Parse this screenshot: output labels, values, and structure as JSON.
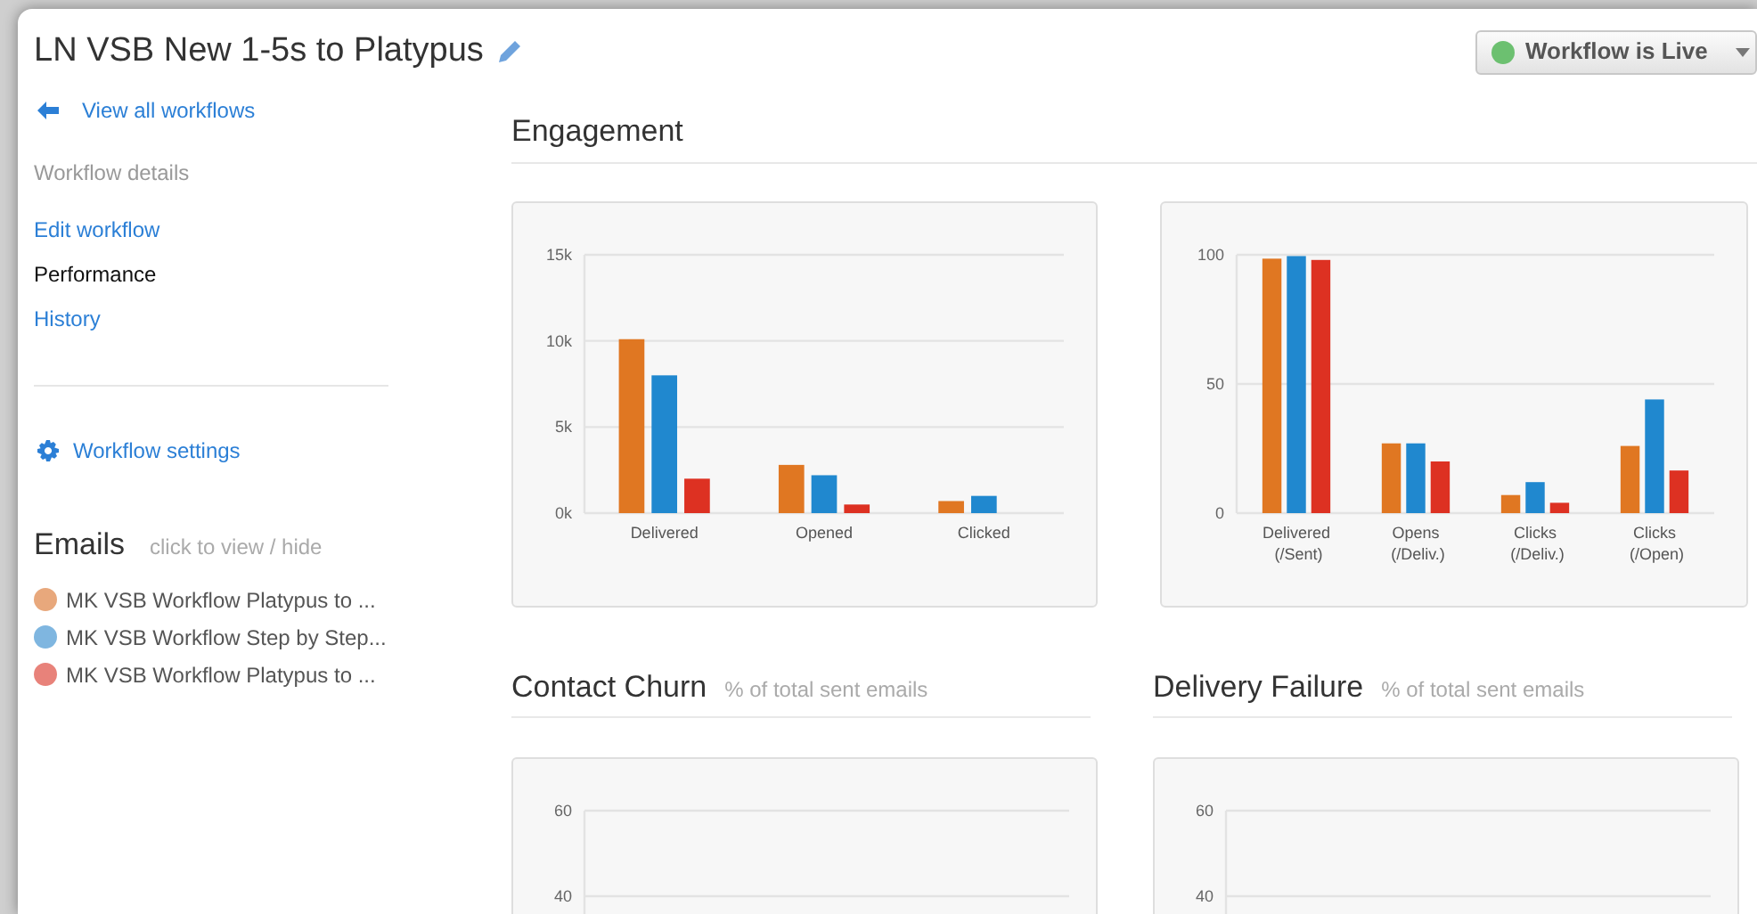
{
  "window": {
    "title": "LN VSB New 1-5s to Platypus"
  },
  "status_button": {
    "label": "Workflow is Live",
    "live": true
  },
  "sidebar": {
    "back_link": "View all workflows",
    "section_label": "Workflow details",
    "items": [
      {
        "label": "Edit workflow",
        "selected": false
      },
      {
        "label": "Performance",
        "selected": true
      },
      {
        "label": "History",
        "selected": false
      }
    ],
    "settings_link": "Workflow settings"
  },
  "emails": {
    "title": "Emails",
    "hint": "click to view / hide",
    "items": [
      {
        "label": "MK VSB Workflow Platypus to ...",
        "color": "#e8a87c"
      },
      {
        "label": "MK VSB Workflow Step by Step...",
        "color": "#7fb6e0"
      },
      {
        "label": "MK VSB Workflow Platypus to ...",
        "color": "#e8827a"
      }
    ]
  },
  "engagement": {
    "title": "Engagement",
    "charts": [
      {
        "chart_data": {
          "type": "bar",
          "categories": [
            "Delivered",
            "Opened",
            "Clicked"
          ],
          "ylim": [
            0,
            15000
          ],
          "yticks": [
            {
              "value": 0,
              "label": "0k"
            },
            {
              "value": 5000,
              "label": "5k"
            },
            {
              "value": 10000,
              "label": "10k"
            },
            {
              "value": 15000,
              "label": "15k"
            }
          ],
          "series": [
            {
              "color": "#e07722",
              "values": [
                10100,
                2800,
                700
              ]
            },
            {
              "color": "#2088cf",
              "values": [
                8000,
                2200,
                1000
              ]
            },
            {
              "color": "#dd3122",
              "values": [
                2000,
                500,
                null
              ]
            }
          ]
        }
      },
      {
        "chart_data": {
          "type": "bar",
          "categories": [
            "Delivered (/Sent)",
            "Opens (/Deliv.)",
            "Clicks (/Deliv.)",
            "Clicks (/Open)"
          ],
          "ylim": [
            0,
            100
          ],
          "yticks": [
            0,
            50,
            100
          ],
          "series": [
            {
              "color": "#e07722",
              "values": [
                98.5,
                27,
                7,
                26
              ]
            },
            {
              "color": "#2088cf",
              "values": [
                99.5,
                27,
                12,
                44
              ]
            },
            {
              "color": "#dd3122",
              "values": [
                98,
                20,
                4,
                16.5
              ]
            }
          ]
        }
      }
    ]
  },
  "panels": [
    {
      "title": "Contact Churn",
      "subtitle": "% of total sent emails",
      "axis_labels": [
        "60",
        "40"
      ]
    },
    {
      "title": "Delivery Failure",
      "subtitle": "% of total sent emails",
      "axis_labels": [
        "60",
        "40"
      ]
    }
  ]
}
